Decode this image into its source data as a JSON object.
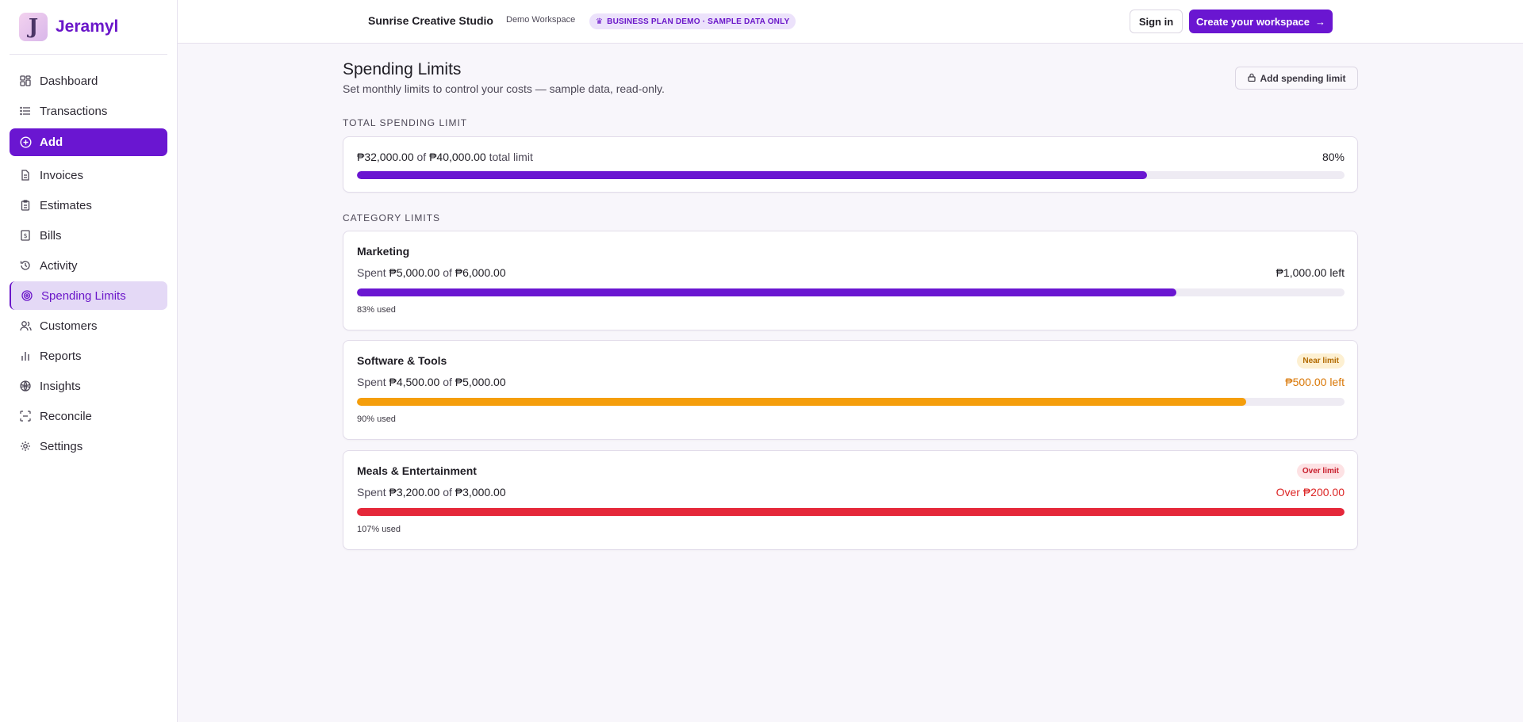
{
  "brand": {
    "name": "Jeramyl",
    "logo_letter": "J"
  },
  "sidebar": {
    "items": [
      {
        "label": "Dashboard",
        "icon": "dashboard-icon"
      },
      {
        "label": "Transactions",
        "icon": "list-icon"
      },
      {
        "label": "Add",
        "icon": "plus-circle-icon"
      },
      {
        "label": "Invoices",
        "icon": "document-icon"
      },
      {
        "label": "Estimates",
        "icon": "clipboard-icon"
      },
      {
        "label": "Bills",
        "icon": "bill-icon"
      },
      {
        "label": "Activity",
        "icon": "history-icon"
      },
      {
        "label": "Spending Limits",
        "icon": "target-icon"
      },
      {
        "label": "Customers",
        "icon": "users-icon"
      },
      {
        "label": "Reports",
        "icon": "bar-chart-icon"
      },
      {
        "label": "Insights",
        "icon": "globe-icon"
      },
      {
        "label": "Reconcile",
        "icon": "scan-icon"
      },
      {
        "label": "Settings",
        "icon": "gear-icon"
      }
    ],
    "active": "Spending Limits"
  },
  "header": {
    "workspace_name": "Sunrise Creative Studio",
    "workspace_sub": "Demo Workspace",
    "demo_badge": "BUSINESS PLAN DEMO · SAMPLE DATA ONLY",
    "signin_label": "Sign in",
    "create_label": "Create your workspace"
  },
  "page": {
    "title": "Spending Limits",
    "subtitle": "Set monthly limits to control your costs — sample data, read-only.",
    "add_limit_label": "Add spending limit"
  },
  "total": {
    "section_label": "TOTAL SPENDING LIMIT",
    "spent": "₱32,000.00",
    "of": "of",
    "limit": "₱40,000.00",
    "suffix": "total limit",
    "percent_label": "80%",
    "percent": 80
  },
  "categories": {
    "section_label": "CATEGORY LIMITS",
    "items": [
      {
        "name": "Marketing",
        "spent_prefix": "Spent",
        "spent": "₱5,000.00",
        "of": "of",
        "limit": "₱6,000.00",
        "remaining": "₱1,000.00 left",
        "used_label": "83% used",
        "percent": 83,
        "badge": "",
        "bar_color": "#6a16d1",
        "remaining_color": "#1f1d24"
      },
      {
        "name": "Software & Tools",
        "spent_prefix": "Spent",
        "spent": "₱4,500.00",
        "of": "of",
        "limit": "₱5,000.00",
        "remaining": "₱500.00 left",
        "used_label": "90% used",
        "percent": 90,
        "badge": "Near limit",
        "badge_bg": "#fdf0d2",
        "badge_color": "#b26a00",
        "bar_color": "#f59e0b",
        "remaining_color": "#d97706"
      },
      {
        "name": "Meals & Entertainment",
        "spent_prefix": "Spent",
        "spent": "₱3,200.00",
        "of": "of",
        "limit": "₱3,000.00",
        "remaining": "Over ₱200.00",
        "used_label": "107% used",
        "percent": 107,
        "badge": "Over limit",
        "badge_bg": "#fde2e4",
        "badge_color": "#c81e2c",
        "bar_color": "#e5283a",
        "remaining_color": "#dc2626"
      }
    ]
  },
  "colors": {
    "accent": "#6a16d1",
    "total_bar": "#6a16d1"
  }
}
